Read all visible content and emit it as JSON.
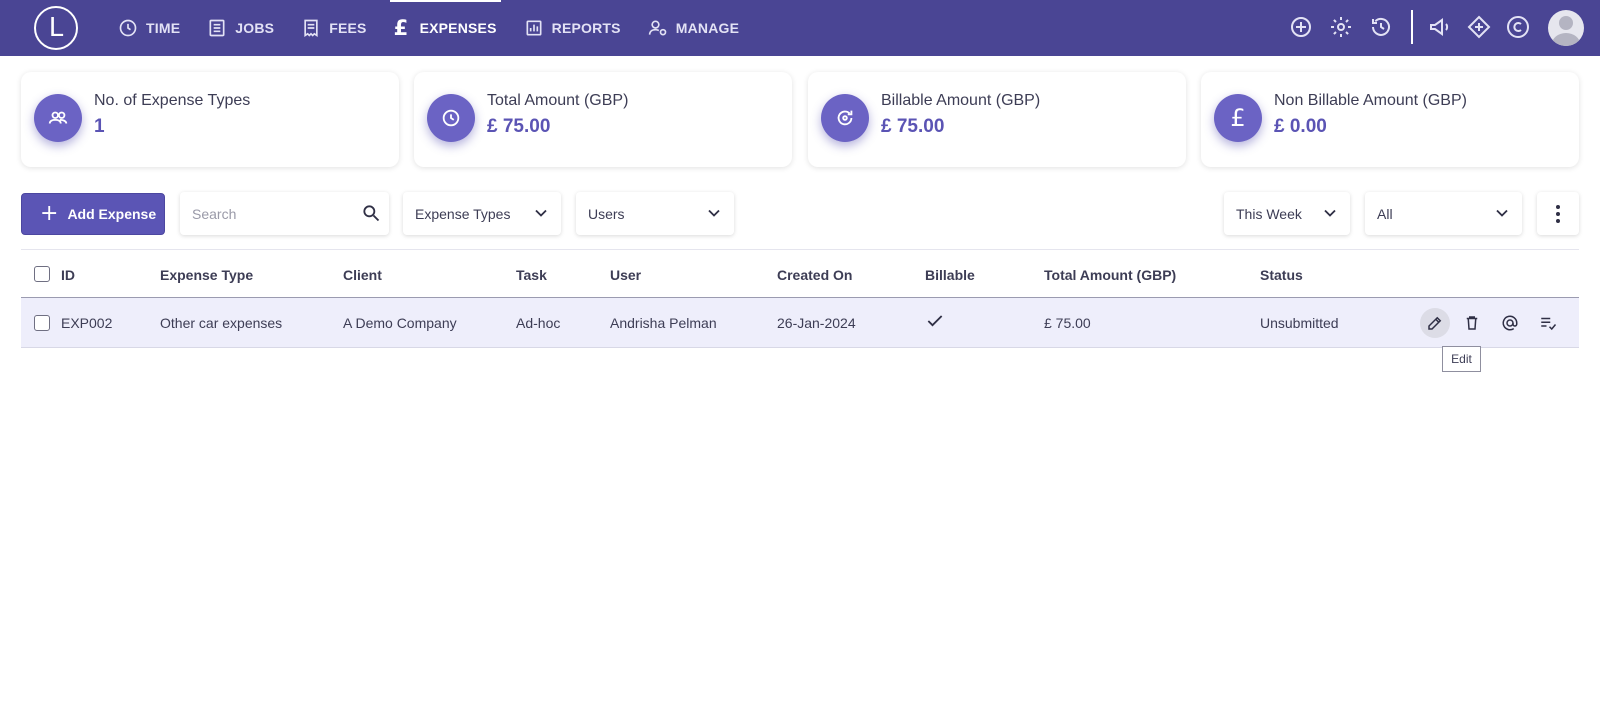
{
  "app": {
    "logo_letter": "L"
  },
  "nav": {
    "items": [
      {
        "label": "TIME",
        "icon": "clock-icon"
      },
      {
        "label": "JOBS",
        "icon": "list-icon"
      },
      {
        "label": "FEES",
        "icon": "receipt-icon"
      },
      {
        "label": "EXPENSES",
        "icon": "pound-icon",
        "active": true
      },
      {
        "label": "REPORTS",
        "icon": "bar-chart-icon"
      },
      {
        "label": "MANAGE",
        "icon": "user-gear-icon"
      }
    ],
    "pound_symbol": "£"
  },
  "header_icons": [
    "add-circle-icon",
    "gear-icon",
    "history-icon",
    "megaphone-icon",
    "diamond-icon",
    "c-logo-icon",
    "avatar"
  ],
  "summary": {
    "cards": [
      {
        "label": "No. of Expense Types",
        "value": "1",
        "icon": "users-icon"
      },
      {
        "label": "Total Amount (GBP)",
        "value": "£ 75.00",
        "icon": "clock-icon"
      },
      {
        "label": "Billable Amount (GBP)",
        "value": "£ 75.00",
        "icon": "refresh-icon"
      },
      {
        "label": "Non Billable Amount (GBP)",
        "value": "£ 0.00",
        "icon": "pound-icon",
        "icon_text": "£"
      }
    ]
  },
  "toolbar": {
    "add_label": "Add Expense",
    "plus": "+",
    "search_placeholder": "Search",
    "expense_types": "Expense Types",
    "users": "Users",
    "period": "This Week",
    "status_filter": "All"
  },
  "table": {
    "columns": [
      "ID",
      "Expense Type",
      "Client",
      "Task",
      "User",
      "Created On",
      "Billable",
      "Total Amount (GBP)",
      "Status"
    ],
    "rows": [
      {
        "id": "EXP002",
        "expense_type": "Other car expenses",
        "client": "A Demo Company",
        "task": "Ad-hoc",
        "user": "Andrisha Pelman",
        "created_on": "26-Jan-2024",
        "billable": true,
        "total": "£ 75.00",
        "status": "Unsubmitted"
      }
    ],
    "row_actions": [
      "edit-icon",
      "delete-icon",
      "mention-icon",
      "checklist-icon"
    ]
  },
  "tooltip": {
    "text": "Edit"
  },
  "colors": {
    "topbar": "#4a4594",
    "accent": "#5b54b4",
    "row_highlight": "#eeeefb"
  }
}
